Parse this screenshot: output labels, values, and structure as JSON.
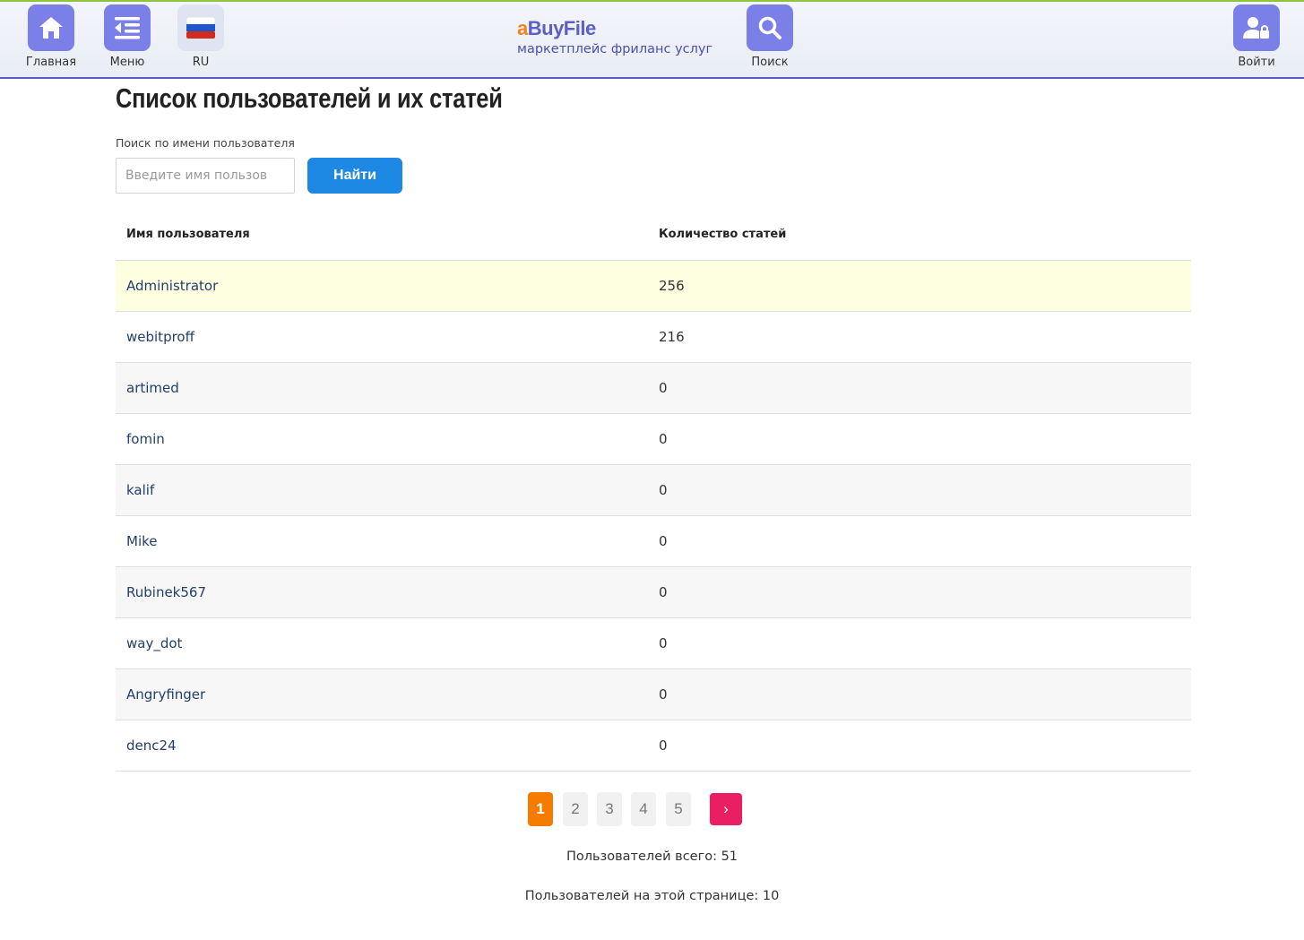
{
  "header": {
    "home_label": "Главная",
    "menu_label": "Меню",
    "lang_label": "RU",
    "search_label": "Поиск",
    "login_label": "Войти",
    "brand": {
      "logo_a": "a",
      "logo_rest": "BuyFile",
      "tagline": "маркетплейс фриланс услуг"
    },
    "colors": {
      "accent": "#7b7fe8",
      "brand_orange": "#f5821f",
      "brand_blue": "#5b5fc7"
    }
  },
  "page": {
    "title": "Список пользователей и их статей",
    "search": {
      "label": "Поиск по имени пользователя",
      "placeholder": "Введите имя пользов",
      "value": "",
      "button": "Найти"
    }
  },
  "table": {
    "columns": [
      "Имя пользователя",
      "Количество статей"
    ],
    "rows": [
      {
        "name": "Administrator",
        "count": "256"
      },
      {
        "name": "webitproff",
        "count": "216"
      },
      {
        "name": "artimed",
        "count": "0"
      },
      {
        "name": "fomin",
        "count": "0"
      },
      {
        "name": "kalif",
        "count": "0"
      },
      {
        "name": "Mike",
        "count": "0"
      },
      {
        "name": "Rubinek567",
        "count": "0"
      },
      {
        "name": "way_dot",
        "count": "0"
      },
      {
        "name": "Angryfinger",
        "count": "0"
      },
      {
        "name": "denc24",
        "count": "0"
      }
    ]
  },
  "pagination": {
    "pages": [
      "1",
      "2",
      "3",
      "4",
      "5"
    ],
    "active": "1",
    "next": "›"
  },
  "footer": {
    "total": "Пользователей всего: 51",
    "on_page": "Пользователей на этой странице: 10"
  }
}
